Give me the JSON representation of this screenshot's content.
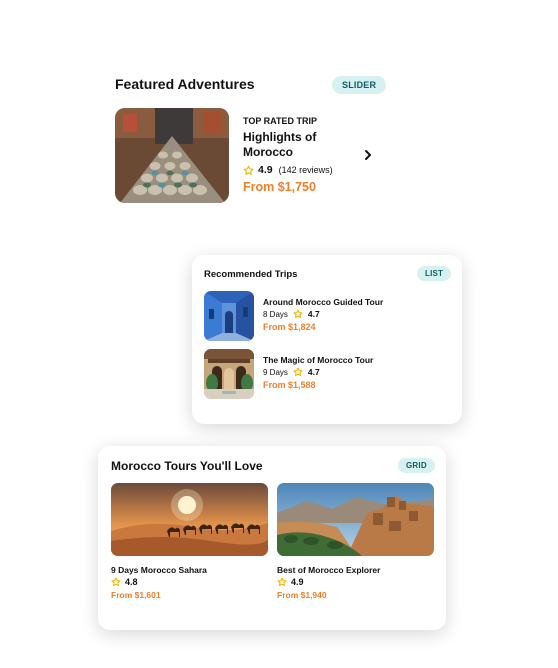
{
  "featured": {
    "title": "Featured Adventures",
    "badge": "SLIDER",
    "eyebrow": "TOP RATED TRIP",
    "name": "Highlights of Morocco",
    "rating": "4.9",
    "reviews": "(142 reviews)",
    "price": "From $1,750",
    "image_icon": "moroccan-market-pottery-image"
  },
  "recommended": {
    "title": "Recommended Trips",
    "badge": "LIST",
    "items": [
      {
        "name": "Around Morocco Guided Tour",
        "days": "8 Days",
        "rating": "4.7",
        "price": "From $1,824",
        "image_icon": "blue-alley-image"
      },
      {
        "name": "The Magic of Morocco Tour",
        "days": "9 Days",
        "rating": "4.7",
        "price": "From $1,588",
        "image_icon": "riad-courtyard-image"
      }
    ]
  },
  "grid": {
    "title": "Morocco Tours You'll Love",
    "badge": "GRID",
    "items": [
      {
        "name": "9 Days Morocco Sahara",
        "rating": "4.8",
        "price": "From $1,601",
        "image_icon": "desert-camels-image"
      },
      {
        "name": "Best of Morocco Explorer",
        "rating": "4.9",
        "price": "From $1,940",
        "image_icon": "kasbah-valley-image"
      }
    ]
  },
  "colors": {
    "accent": "#f07f2a",
    "badge_bg": "#d7f1f1",
    "badge_text": "#0e5e66",
    "star": "#f5b400"
  }
}
